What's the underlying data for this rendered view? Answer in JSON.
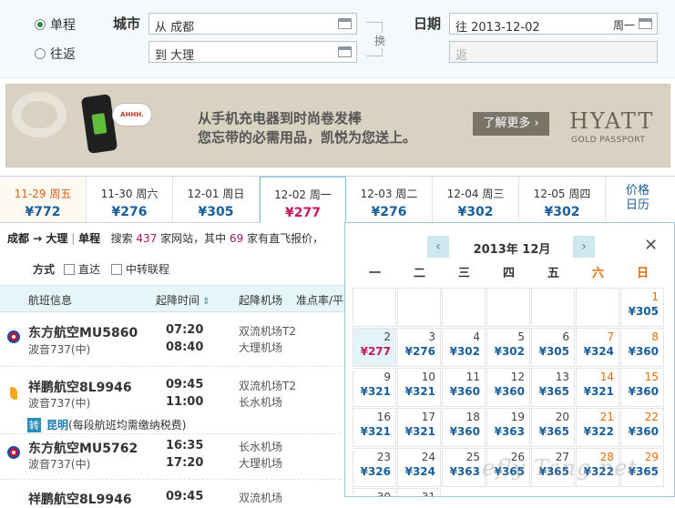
{
  "search": {
    "trip_oneway": "单程",
    "trip_round": "往返",
    "city_label": "城市",
    "from_value": "从 成都",
    "to_value": "到 大理",
    "swap_label": "换",
    "date_label": "日期",
    "depart_value": "往 2013-12-02",
    "depart_weekday": "周一",
    "return_placeholder": "返"
  },
  "banner": {
    "bubble": "AHHH.",
    "line1": "从手机充电器到时尚卷发棒",
    "line2": "您忘带的必需用品，凯悦为您送上。",
    "cta": "了解更多 ›",
    "brand": "HYATT",
    "brand_sub": "GOLD PASSPORT"
  },
  "date_tabs": [
    {
      "date": "11-29 周五",
      "price": "¥772"
    },
    {
      "date": "11-30 周六",
      "price": "¥276"
    },
    {
      "date": "12-01 周日",
      "price": "¥305"
    },
    {
      "date": "12-02 周一",
      "price": "¥277"
    },
    {
      "date": "12-03 周二",
      "price": "¥276"
    },
    {
      "date": "12-04 周三",
      "price": "¥302"
    },
    {
      "date": "12-05 周四",
      "price": "¥302"
    }
  ],
  "price_calendar_tab": {
    "line1": "价格",
    "line2": "日历"
  },
  "summary": {
    "route": "成都 → 大理",
    "trip": "单程",
    "text_a": "搜索",
    "site_count": "437",
    "text_b": "家网站，其中",
    "direct_count": "69",
    "text_c": "家有直飞报价，"
  },
  "filter": {
    "label": "方式",
    "direct": "直达",
    "transfer": "中转联程"
  },
  "list_header": {
    "info": "航班信息",
    "time": "起降时间",
    "airport": "起降机场",
    "ontime": "准点率/平"
  },
  "flights": [
    {
      "name": "东方航空MU5860",
      "plane": "波音737(中)",
      "dep": "07:20",
      "arr": "08:40",
      "dep_ap": "双流机场T2",
      "arr_ap": "大理机场"
    },
    {
      "name": "祥鹏航空8L9946",
      "plane": "波音737(中)",
      "dep": "09:45",
      "arr": "11:00",
      "dep_ap": "双流机场T2",
      "arr_ap": "长水机场"
    },
    {
      "name": "东方航空MU5762",
      "plane": "波音737(中)",
      "dep": "16:35",
      "arr": "17:20",
      "dep_ap": "长水机场",
      "arr_ap": "大理机场"
    },
    {
      "name": "祥鹏航空8L9946",
      "dep": "09:45",
      "dep_ap": "双流机场"
    }
  ],
  "transfer": {
    "tag": "转",
    "city": "昆明",
    "note": "(每段航班均需缴纳税费)"
  },
  "calendar": {
    "title": "2013年 12月",
    "prev": "‹",
    "next": "›",
    "close": "✕",
    "weekdays": [
      "一",
      "二",
      "三",
      "四",
      "五",
      "六",
      "日"
    ],
    "days": [
      {
        "d": "1",
        "p": "¥305"
      },
      {
        "d": "2",
        "p": "¥277"
      },
      {
        "d": "3",
        "p": "¥276"
      },
      {
        "d": "4",
        "p": "¥302"
      },
      {
        "d": "5",
        "p": "¥302"
      },
      {
        "d": "6",
        "p": "¥305"
      },
      {
        "d": "7",
        "p": "¥324"
      },
      {
        "d": "8",
        "p": "¥360"
      },
      {
        "d": "9",
        "p": "¥321"
      },
      {
        "d": "10",
        "p": "¥321"
      },
      {
        "d": "11",
        "p": "¥360"
      },
      {
        "d": "12",
        "p": "¥360"
      },
      {
        "d": "13",
        "p": "¥365"
      },
      {
        "d": "14",
        "p": "¥321"
      },
      {
        "d": "15",
        "p": "¥360"
      },
      {
        "d": "16",
        "p": "¥321"
      },
      {
        "d": "17",
        "p": "¥321"
      },
      {
        "d": "18",
        "p": "¥360"
      },
      {
        "d": "19",
        "p": "¥363"
      },
      {
        "d": "20",
        "p": "¥365"
      },
      {
        "d": "21",
        "p": "¥322"
      },
      {
        "d": "22",
        "p": "¥360"
      },
      {
        "d": "23",
        "p": "¥326"
      },
      {
        "d": "24",
        "p": "¥324"
      },
      {
        "d": "25",
        "p": "¥363"
      },
      {
        "d": "26",
        "p": "¥365"
      },
      {
        "d": "27",
        "p": "¥365"
      },
      {
        "d": "28",
        "p": "¥322"
      },
      {
        "d": "29",
        "p": "¥365"
      },
      {
        "d": "30",
        "p": ""
      },
      {
        "d": "31",
        "p": ""
      }
    ],
    "watermark": "efly Tang.net"
  },
  "colors": {
    "accent": "#1a5e9a",
    "selected_price": "#c2185b",
    "weekend": "#e36c0a"
  }
}
